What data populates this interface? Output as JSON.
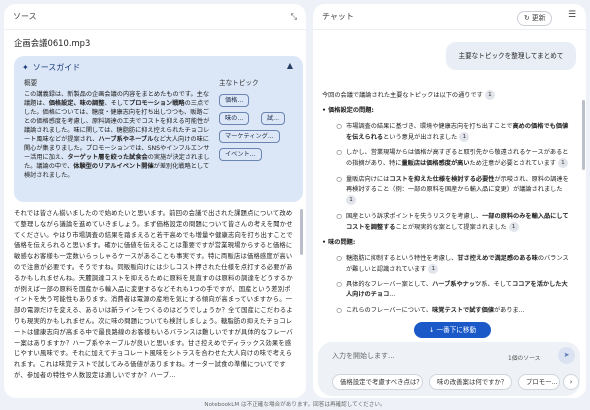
{
  "left": {
    "header_title": "ソース",
    "filename": "企画会議0610.mp3",
    "guide": {
      "title": "ソースガイド",
      "summary_label": "概要",
      "topics_label": "主なトピック",
      "summary_parts": [
        {
          "t": "この講義録は、新製品の企画会議の内容をまとめたものです。主な議題は、",
          "b": false
        },
        {
          "t": "価格設定、味の調整",
          "b": true
        },
        {
          "t": "、そして",
          "b": false
        },
        {
          "t": "プロモーション戦略",
          "b": true
        },
        {
          "t": "の三点でした。価格については、糖度・健康志向を打ち出しつつも、販路ごとの価格感度を考慮し、原料調達の工夫でコストを抑える可能性が議論されました。味に関しては、糖脂肪に抑え控えられたチョコレート風味などが提案され、",
          "b": false
        },
        {
          "t": "ハーブ系やネーブル",
          "b": true
        },
        {
          "t": "など大人向けの味に関心が集まりました。プロモーションでは、SNSやインフルエンサー活用に加え、",
          "b": false
        },
        {
          "t": "ターゲット層を絞った試食会",
          "b": true
        },
        {
          "t": "の実施が決定されました。議論の中で、",
          "b": false
        },
        {
          "t": "体験型のリアルイベント開催",
          "b": true
        },
        {
          "t": "が差別化戦略として検討されました。",
          "b": false
        }
      ],
      "topics": [
        "価格...",
        "味の...",
        "試...",
        "マーケティング...",
        "イベント..."
      ]
    },
    "transcript": "それでは皆さん揃いましたので始めたいと思います。前回の会議で出された課題点について改めて整理しながら議論を進めていきましょう。まず価格設定の問題について皆さんの考えを聞かせてください。やはり市場調査の結果を踏まえると若干高めでも増量や健康志向を打ち出すことで価格を伝えられると思います。確かに価値を伝えることは重要ですが営業現場からすると価格に敏感なお客様も一定数いらっしゃるケースがあることも事実です。特に両販店は価格感度が高いので注意が必要です。そうですね。同販販向けには少しコスト押された仕様を点打する必要があるかもしれませんね。天麓調達コストを抑えるために原料を見直すのは原料の調達をどうするかが例えば一部の原料を国産から輸入品に変更するなどそれも1つの手ですが、国産という差別ポイントを失う可能性もあります。消費者は電源の産地を気にする傾向が高まっていますから。一部の電源だけを変える、あるいは新ラインをつくるのはどうでしょうか？全て国産にこだわるよりも現実的かもしれません。次に味の問題についても検討しましょう。糖脂肪の抑えたチョコレートは健康志向が高まる中で最良路線のお客様もいるバランスは難しいですが具体的なフレーバー案はありますか？ハーブ系やネーブルが良いと思います。甘さ控えめでディラックス効果を感じやすい風味です。それに加えてチョコレート風味をシトラスを合わせた大人向けの味で考えられます。これは味覚テストで試してみる価値がありますね。オーター試食の準備についてですが、参加者の特性や人数設定は適しいですか？ハーブ..."
  },
  "right": {
    "header_title": "チャット",
    "refresh_label": "更新",
    "user_message": "主要なトピックを整理してまとめて",
    "answer_intro": "今回の会議で議論された主要なトピックは以下の通りです",
    "section1_title": "価格設定の問題",
    "section1_items": [
      {
        "pre": "市場調査の結果に基づき、環境や健康志向を打ち出すことで",
        "bold": "高めの価格でも価値を伝えられる",
        "post": "という意見が出されました",
        "cite": "1"
      },
      {
        "pre": "しかし、営業現場からは価格が高すぎると取引先から敬遠されるケースがあるとの指摘があり、特に",
        "bold": "量販店は価格感度が高い",
        "post": "ため注意が必要とされています",
        "cite": "1"
      },
      {
        "pre": "量販店向けには",
        "bold": "コストを抑えた仕様を検討する必要性",
        "post": "が示唆され、原料の調達を再検討すること（例：一部の原料を国産から輸入品に変更）が議論されました",
        "cite": "1"
      },
      {
        "pre": "国産という訴求ポイントを失うリスクを考慮し、",
        "bold": "一部の原料のみを輸入品にしてコストを調整する",
        "post": "ことが現実的な案として提案されました",
        "cite": "1"
      }
    ],
    "section2_title": "味の問題",
    "section2_items": [
      {
        "pre": "糖脂肪に抑制するという特性を考慮し、",
        "bold": "甘さ控えめで満足感のある味",
        "post": "のバランスが難しいと認識されています",
        "cite": "1"
      },
      {
        "pre": "具体的なフレーバー案として、",
        "bold": "ハーブ系やナッツ",
        "post": "系、そして",
        "bold2": "ココアを活かした大人向けのチョコ",
        "post2": "...",
        "cite": ""
      },
      {
        "pre": "これらのフレーバーについて、",
        "bold": "味覚テストで試す価値",
        "post": "がありま...",
        "cite": ""
      }
    ],
    "jump_label": "一番下に移動",
    "input_placeholder": "入力を開始します...",
    "source_count": "1個のソース",
    "suggestions": [
      "価格設定で考慮すべき点は？",
      "味の改善案は何ですか？",
      "プロモー..."
    ]
  },
  "footer": "NotebookLM は不正確な場合があります。回答は再確認してください。"
}
